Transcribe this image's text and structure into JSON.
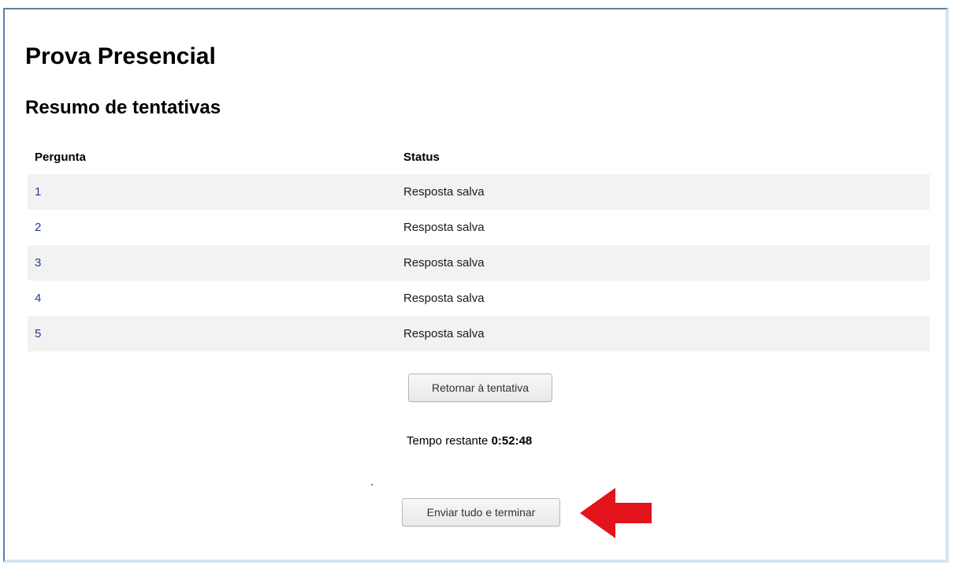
{
  "page": {
    "title": "Prova Presencial",
    "section_title": "Resumo de tentativas"
  },
  "table": {
    "headers": {
      "question": "Pergunta",
      "status": "Status"
    },
    "rows": [
      {
        "question": "1",
        "status": "Resposta salva"
      },
      {
        "question": "2",
        "status": "Resposta salva"
      },
      {
        "question": "3",
        "status": "Resposta salva"
      },
      {
        "question": "4",
        "status": "Resposta salva"
      },
      {
        "question": "5",
        "status": "Resposta salva"
      }
    ]
  },
  "actions": {
    "return_label": "Retornar à tentativa",
    "submit_label": "Enviar tudo e terminar"
  },
  "timer": {
    "label": "Tempo restante",
    "value": "0:52:48"
  },
  "annotation": {
    "arrow_icon": "red-arrow-left-icon",
    "arrow_color": "#e3141b"
  },
  "colors": {
    "link": "#1f3a93",
    "row_striped": "#f2f2f2",
    "frame_border": "#5b7fa3"
  }
}
